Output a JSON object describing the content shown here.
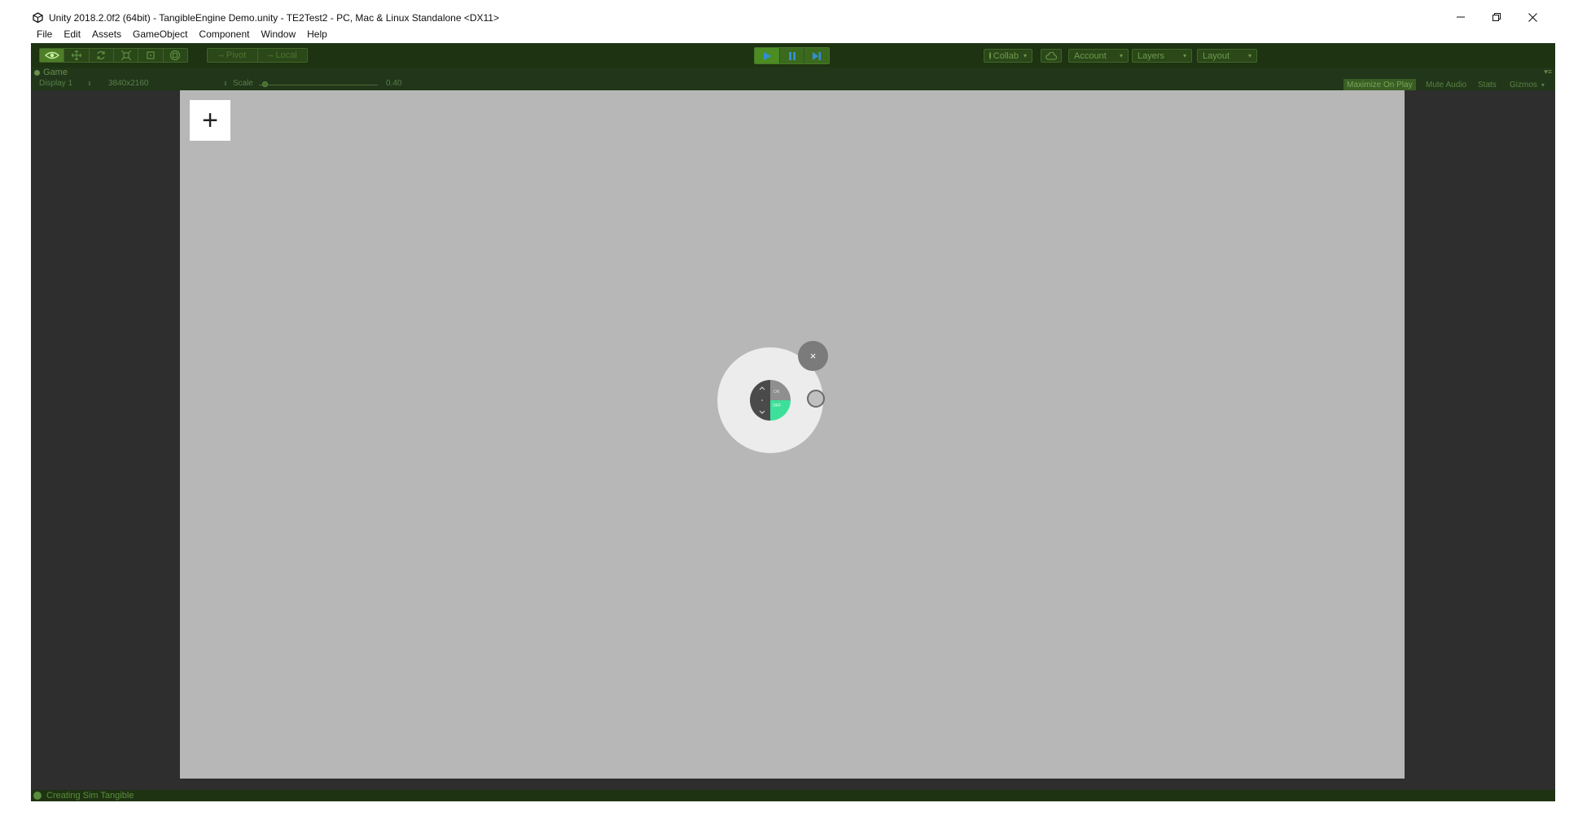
{
  "window": {
    "title": "Unity 2018.2.0f2 (64bit) - TangibleEngine Demo.unity - TE2Test2 - PC, Mac & Linux Standalone <DX11>",
    "controls": [
      "minimize-icon",
      "restore-icon",
      "close-icon"
    ]
  },
  "menu": [
    "File",
    "Edit",
    "Assets",
    "GameObject",
    "Component",
    "Window",
    "Help"
  ],
  "toolbar": {
    "tools": [
      "view-tool-icon",
      "move-tool-icon",
      "rotate-tool-icon",
      "scale-tool-icon",
      "rect-tool-icon",
      "transform-tool-icon"
    ],
    "pivot_label": "Pivot",
    "local_label": "Local",
    "play": [
      "play-icon",
      "pause-icon",
      "step-icon"
    ],
    "collab_label": "Collab",
    "account_label": "Account",
    "layers_label": "Layers",
    "layout_label": "Layout"
  },
  "game_view": {
    "tab_label": "Game",
    "display_label": "Display 1",
    "resolution_label": "3840x2160",
    "scale_label": "Scale",
    "scale_value": "0.40",
    "maximize_label": "Maximize On Play",
    "mute_label": "Mute Audio",
    "stats_label": "Stats",
    "gizmos_label": "Gizmos"
  },
  "canvas": {
    "add_symbol": "+",
    "close_symbol": "×",
    "dial_on_label": "ON",
    "dial_off_label": "OFF"
  },
  "status": {
    "message": "Creating Sim Tangible"
  },
  "colors": {
    "play_tint": "#27351a",
    "canvas_bg": "#b7b7b7",
    "accent_green": "#3de09a"
  }
}
